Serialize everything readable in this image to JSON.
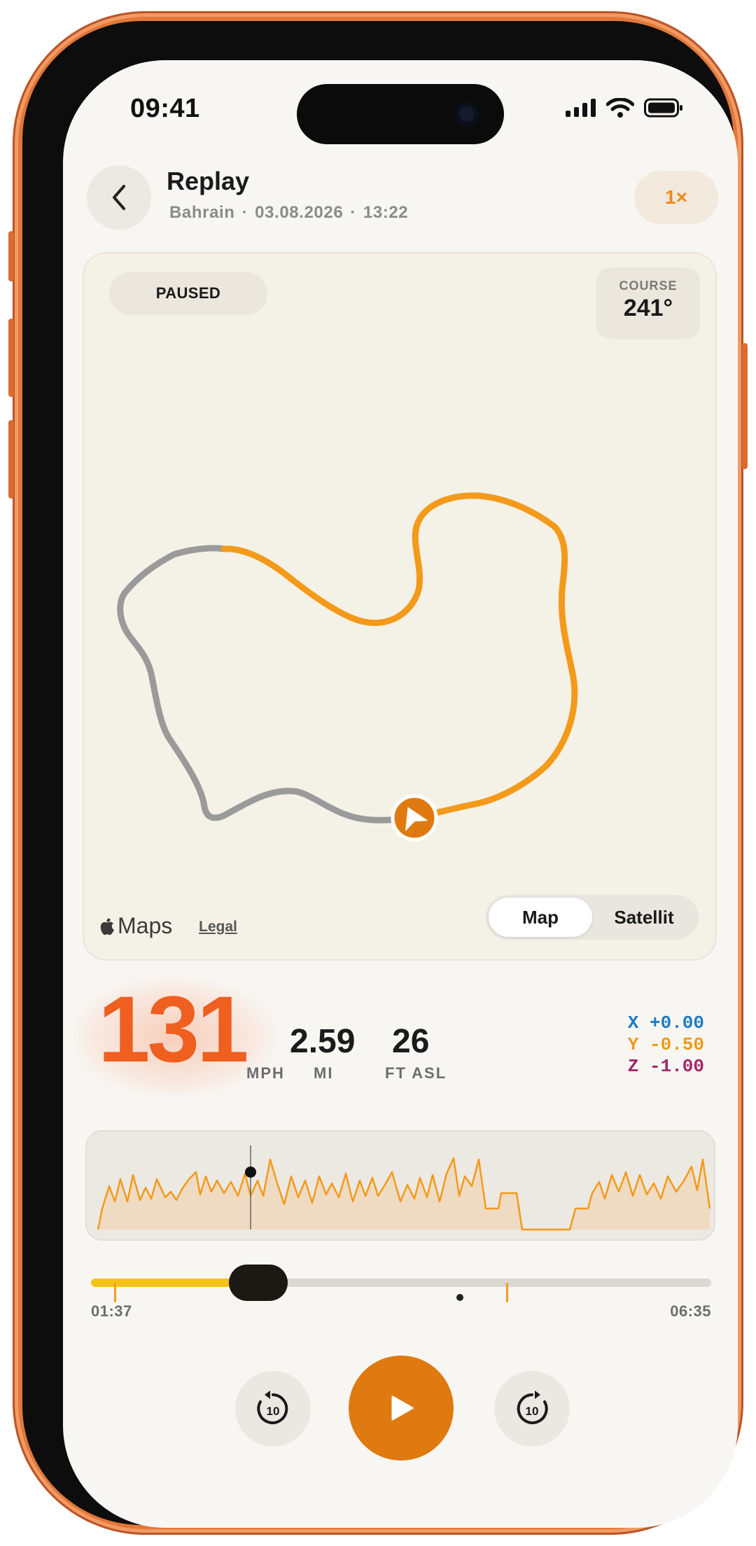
{
  "status": {
    "time": "09:41"
  },
  "header": {
    "title": "Replay",
    "location": "Bahrain",
    "date": "03.08.2026",
    "time": "13:22",
    "separator": "·",
    "speed_multiplier": "1×"
  },
  "map": {
    "state_label": "PAUSED",
    "course_label": "COURSE",
    "course_value": "241°",
    "provider": "Maps",
    "legal": "Legal",
    "view_options": [
      "Map",
      "Satellit"
    ],
    "active_view": "Map"
  },
  "stats": {
    "speed_value": "131",
    "speed_unit": "MPH",
    "distance_value": "2.59",
    "distance_unit": "MI",
    "altitude_value": "26",
    "altitude_unit": "FT ASL",
    "accel": [
      {
        "axis": "X",
        "value": "+0.00",
        "color": "#1e7ac4"
      },
      {
        "axis": "Y",
        "value": "-0.50",
        "color": "#ee9a14"
      },
      {
        "axis": "Z",
        "value": "-1.00",
        "color": "#a02869"
      }
    ]
  },
  "timeline": {
    "start_time": "01:37",
    "end_time": "06:35",
    "progress": 0.27
  },
  "controls": {
    "skip_back_seconds": "10",
    "skip_forward_seconds": "10"
  },
  "colors": {
    "accent": "#df7a10",
    "track_done": "#9a9a9a",
    "track_ahead": "#f39a1a",
    "speed": "#ef5f1f",
    "scrub_fill": "#f5c316"
  }
}
